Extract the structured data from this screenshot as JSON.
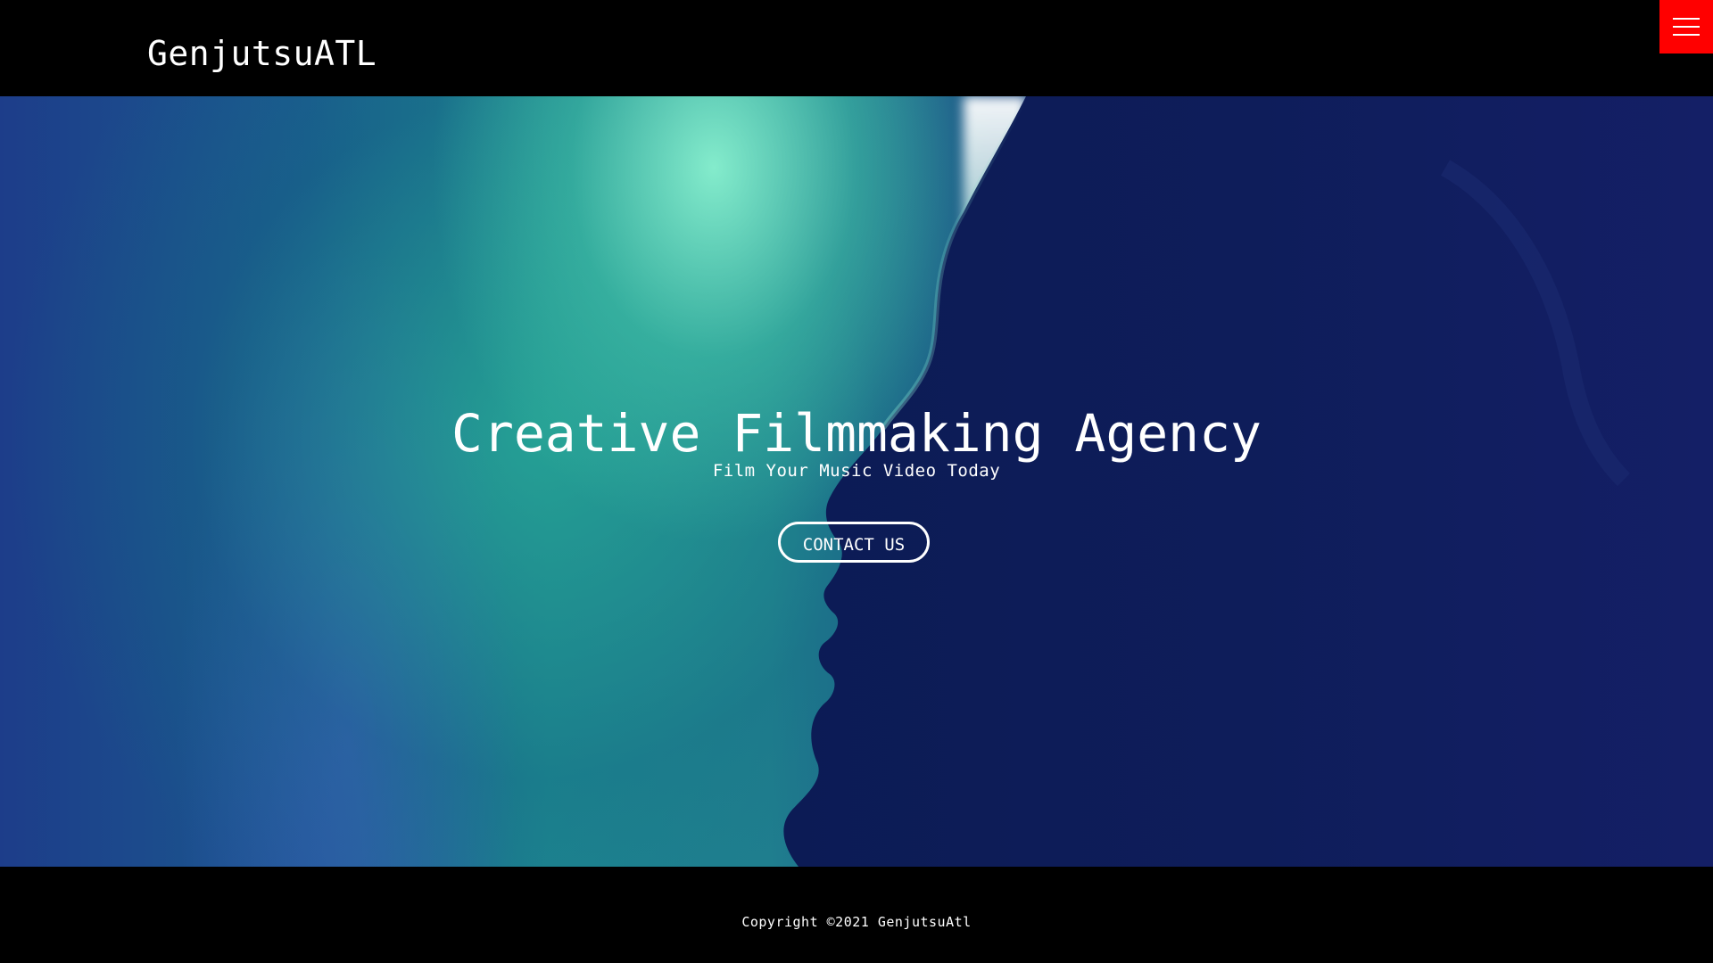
{
  "header": {
    "brand": "GenjutsuATL",
    "menu_icon": "hamburger-menu-icon",
    "menu_color": "#ff0000"
  },
  "hero": {
    "title": "Creative Filmmaking Agency",
    "subtitle": "Film Your Music Video Today",
    "cta_label": "CONTACT US",
    "background_image": "silhouette of a person's face against teal and blue light"
  },
  "footer": {
    "copyright": "Copyright ©2021 GenjutsuAtl"
  },
  "colors": {
    "background": "#000000",
    "accent": "#ff0000",
    "text": "#ffffff"
  }
}
